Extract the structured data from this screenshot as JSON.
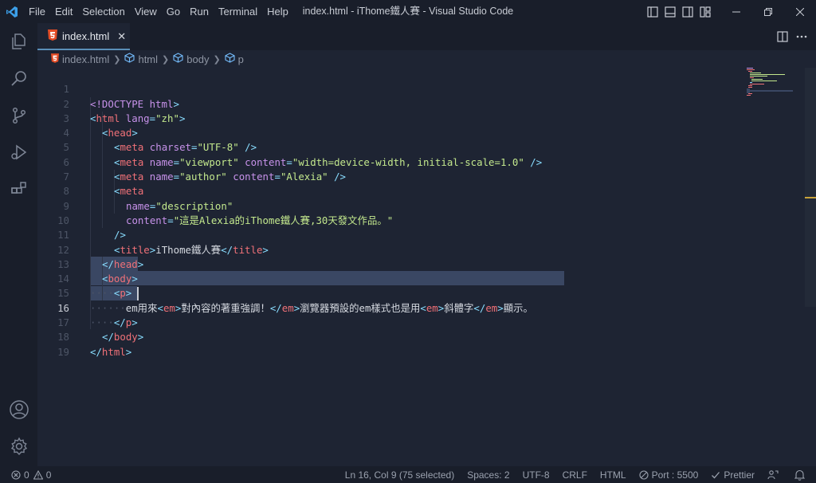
{
  "menu": [
    "File",
    "Edit",
    "Selection",
    "View",
    "Go",
    "Run",
    "Terminal",
    "Help"
  ],
  "window_title": "index.html - iThome鐵人賽 - Visual Studio Code",
  "window_controls": [
    "minimize",
    "restore",
    "close"
  ],
  "tab": {
    "label": "index.html",
    "close": "✕"
  },
  "breadcrumb": [
    "index.html",
    "html",
    "body",
    "p"
  ],
  "editor": {
    "lines": [
      {
        "n": "1"
      },
      {
        "n": "2"
      },
      {
        "n": "3"
      },
      {
        "n": "4"
      },
      {
        "n": "5"
      },
      {
        "n": "6"
      },
      {
        "n": "7"
      },
      {
        "n": "8"
      },
      {
        "n": "9"
      },
      {
        "n": "10"
      },
      {
        "n": "11"
      },
      {
        "n": "12"
      },
      {
        "n": "13"
      },
      {
        "n": "14"
      },
      {
        "n": "15"
      },
      {
        "n": "16"
      },
      {
        "n": "17"
      },
      {
        "n": "18"
      },
      {
        "n": "19"
      }
    ],
    "tokens": {
      "l1": [
        "<!DOCTYPE",
        " html",
        ">"
      ],
      "l2": [
        "<",
        "html",
        " lang",
        "=",
        "\"zh\"",
        ">"
      ],
      "l3": [
        "<",
        "head",
        ">"
      ],
      "l4": [
        "<",
        "meta",
        " charset",
        "=",
        "\"UTF-8\"",
        " />"
      ],
      "l5": [
        "<",
        "meta",
        " name",
        "=",
        "\"viewport\"",
        " content",
        "=",
        "\"width=device-width, initial-scale=1.0\"",
        " />"
      ],
      "l6": [
        "<",
        "meta",
        " name",
        "=",
        "\"author\"",
        " content",
        "=",
        "\"Alexia\"",
        " />"
      ],
      "l7": [
        "<",
        "meta"
      ],
      "l8": [
        "name",
        "=",
        "\"description\""
      ],
      "l9": [
        "content",
        "=",
        "\"這是Alexia的iThome鐵人賽,30天發文作品。\""
      ],
      "l10": [
        "/>"
      ],
      "l11": [
        "<",
        "title",
        ">",
        "iThome鐵人賽",
        "</",
        "title",
        ">"
      ],
      "l12": [
        "</",
        "head",
        ">"
      ],
      "l13": [
        "<",
        "body",
        ">"
      ],
      "l14": [
        "····",
        "<",
        "p",
        ">"
      ],
      "l15": [
        "······",
        "em用來",
        "<",
        "em",
        ">",
        "對內容的著重強調！",
        "</",
        "em",
        ">",
        "瀏覽器預設的em樣式也是用",
        "<",
        "em",
        ">",
        "斜體字",
        "</",
        "em",
        ">",
        "顯示。"
      ],
      "l16": [
        "····",
        "</",
        "p",
        ">"
      ],
      "l17": [
        "</",
        "body",
        ">"
      ],
      "l18": [
        "</",
        "html",
        ">"
      ]
    }
  },
  "status": {
    "errors": "0",
    "warnings": "0",
    "position": "Ln 16, Col 9 (75 selected)",
    "spaces": "Spaces: 2",
    "encoding": "UTF-8",
    "eol": "CRLF",
    "language": "HTML",
    "port": "Port : 5500",
    "prettier": "Prettier"
  },
  "colors": {
    "background": "#1e2433",
    "chrome": "#191e2a",
    "tag": "#f07178",
    "attribute": "#c792ea",
    "string": "#c3e88d",
    "punctuation": "#89ddff",
    "selection": "#3a4763",
    "html_icon": "#e44d26",
    "vscode_logo": "#3c9fe8"
  }
}
